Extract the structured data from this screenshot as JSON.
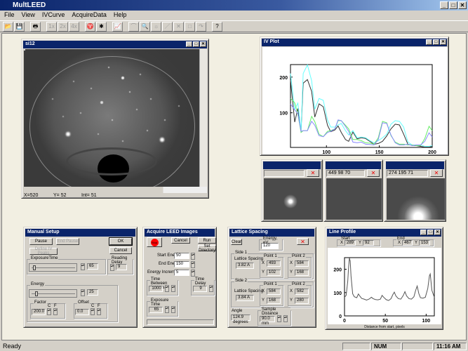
{
  "app": {
    "title": "MultLEED"
  },
  "menu": [
    "File",
    "View",
    "IVCurve",
    "AcquireData",
    "Help"
  ],
  "toolbar": [
    {
      "icon": "open-icon",
      "label": "📂"
    },
    {
      "icon": "save-icon",
      "label": "💾"
    },
    {
      "icon": "print-icon",
      "label": "🖶"
    },
    {
      "icon": "zoom-1x-icon",
      "label": "1x"
    },
    {
      "icon": "zoom-2x-icon",
      "label": "2x"
    },
    {
      "icon": "zoom-4x-icon",
      "label": "4x"
    },
    {
      "icon": "spot-icon",
      "label": "♈"
    },
    {
      "icon": "mark-icon",
      "label": "✱"
    },
    {
      "icon": "chart-icon",
      "label": "📈"
    },
    {
      "icon": "arc-icon",
      "label": "⌒"
    },
    {
      "icon": "magnify-icon",
      "label": "🔍"
    },
    {
      "icon": "sun-icon",
      "label": "☼"
    },
    {
      "icon": "line-icon",
      "label": "／"
    },
    {
      "icon": "cross-icon",
      "label": "✕"
    },
    {
      "icon": "square-icon",
      "label": "□"
    },
    {
      "icon": "curve-icon",
      "label": "↷"
    },
    {
      "icon": "help-icon",
      "label": "?"
    }
  ],
  "image_window": {
    "title": "si12",
    "status": [
      "X=520",
      "Y= 52",
      "Int= 51"
    ]
  },
  "iv_plot": {
    "title": "IV Plot"
  },
  "spot_windows": [
    {
      "readout": ""
    },
    {
      "readout": "449  98   70"
    },
    {
      "readout": "274 195   71"
    }
  ],
  "manual_setup": {
    "title": "Manual Setup",
    "pause": "Pause",
    "end_pause": "End Pause",
    "define": "Define IV Peaks",
    "ok": "OK",
    "cancel": "Cancel",
    "exposure_label": "ExposureTime",
    "exposure_value": "65",
    "reading_delay_label": "Reading Delay",
    "reading_delay_value": "9",
    "energy_label": "Energy",
    "energy_value": "25",
    "factor_label": "Factor",
    "factor_value": "200.0",
    "offset_label": "Offset",
    "offset_value": "0.0",
    "c": "C",
    "f": "F"
  },
  "acquire": {
    "title": "Acquire LEED Images",
    "stop": "Stop",
    "cancel": "Cancel",
    "run": "Run",
    "set_dir": "Set Directory",
    "start_label": "Start Energy",
    "start_value": "50",
    "end_label": "End Energy",
    "end_value": "150",
    "inc_label": "Energy Increment",
    "inc_value": "5",
    "tbi_label": "Time Between Images",
    "tbi_value": "1000",
    "delay_label": "Time Delay",
    "delay_value": "9",
    "exp_label": "Exposure Time",
    "exp_value": "65",
    "c": "C",
    "f": "F"
  },
  "lattice": {
    "title": "Lattice Spacing",
    "clear": "Clear",
    "energy_label": "Energy, eV",
    "energy_value": "120",
    "side1": "Side 1",
    "side2": "Side 2",
    "ls_label": "Lattice Spacing",
    "ls1": "3.82 A",
    "ls2": "3.84 A",
    "p1": "Point 1",
    "p2": "Point 2",
    "x": "X",
    "y": "Y",
    "s1p1x": "493",
    "s1p1y": "102",
    "s1p2x": "584",
    "s1p2y": "168",
    "s2p1x": "584",
    "s2p1y": "168",
    "s2p2x": "582",
    "s2p2y": "280",
    "angle_label": "Angle",
    "angle_value": "124.9 degrees",
    "sd_label": "Sample Distance",
    "sd_value": "90.0 mm",
    "c": "C",
    "f": "F"
  },
  "line_profile": {
    "title": "Line Profile",
    "start": "Start",
    "end": "End",
    "x": "X",
    "y": "Y",
    "sx": "289",
    "sy": "92",
    "ex": "467",
    "ey": "153",
    "xlabel": "Distance from start, pixels"
  },
  "status": {
    "text": "Ready",
    "num": "NUM",
    "time": "11:16 AM"
  },
  "chart_data": [
    {
      "type": "line",
      "title": "IV Plot",
      "xlim": [
        66,
        200
      ],
      "ylim": [
        3,
        235
      ],
      "xticks": [
        100,
        150,
        200
      ],
      "yticks": [
        100,
        200
      ],
      "x": [
        66,
        70,
        73,
        76,
        78,
        82,
        86,
        89,
        93,
        97,
        101,
        104,
        108,
        111,
        114,
        118,
        121,
        125,
        129,
        133,
        137,
        141,
        145,
        149,
        153,
        157,
        161,
        165,
        169,
        173,
        177,
        181,
        185,
        189,
        193,
        197,
        200
      ],
      "series": [
        {
          "name": "black",
          "color": "#303030",
          "values": [
            192,
            74,
            112,
            50,
            183,
            193,
            160,
            88,
            125,
            117,
            65,
            47,
            52,
            63,
            45,
            25,
            20,
            46,
            27,
            30,
            28,
            20,
            12,
            14,
            20,
            35,
            55,
            68,
            66,
            40,
            12,
            9,
            8,
            6,
            4,
            4,
            6
          ]
        },
        {
          "name": "cyan",
          "color": "#66ffff",
          "values": [
            210,
            110,
            127,
            50,
            210,
            234,
            190,
            110,
            140,
            135,
            80,
            60,
            60,
            66,
            70,
            50,
            38,
            50,
            30,
            32,
            30,
            22,
            16,
            22,
            30,
            40,
            68,
            78,
            76,
            60,
            18,
            10,
            10,
            10,
            6,
            6,
            8
          ]
        },
        {
          "name": "green",
          "color": "#66ee66",
          "values": [
            140,
            128,
            95,
            45,
            50,
            50,
            90,
            75,
            40,
            33,
            48,
            50,
            55,
            78,
            78,
            65,
            55,
            25,
            25,
            22,
            16,
            15,
            12,
            30,
            76,
            72,
            36,
            18,
            12,
            12,
            10,
            10,
            8,
            8,
            28,
            62,
            50
          ]
        },
        {
          "name": "blue",
          "color": "#8888ff",
          "values": [
            125,
            108,
            98,
            48,
            50,
            50,
            76,
            65,
            36,
            33,
            45,
            48,
            55,
            80,
            78,
            62,
            48,
            18,
            16,
            18,
            12,
            11,
            10,
            25,
            72,
            70,
            38,
            16,
            10,
            10,
            12,
            8,
            10,
            10,
            20,
            44,
            32
          ]
        }
      ]
    },
    {
      "type": "line",
      "title": "Line Profile",
      "xlabel": "Distance from start, pixels",
      "xlim": [
        0,
        110
      ],
      "ylim": [
        0,
        250
      ],
      "xticks": [
        0,
        50,
        100
      ],
      "yticks": [
        0,
        100,
        200
      ],
      "x": [
        0,
        2,
        4,
        5,
        6,
        7,
        8,
        10,
        12,
        15,
        17,
        19,
        21,
        24,
        27,
        30,
        33,
        35,
        38,
        41,
        44,
        46,
        48,
        51,
        54,
        57,
        59,
        61,
        63,
        66,
        69,
        72,
        74,
        76,
        79,
        82,
        85,
        87,
        89,
        91,
        93,
        96,
        99,
        102,
        104,
        105,
        107,
        110
      ],
      "values": [
        80,
        88,
        150,
        210,
        248,
        235,
        170,
        95,
        82,
        78,
        94,
        84,
        75,
        72,
        68,
        72,
        80,
        74,
        70,
        69,
        72,
        88,
        80,
        70,
        66,
        74,
        90,
        102,
        85,
        74,
        72,
        88,
        104,
        86,
        74,
        72,
        82,
        108,
        128,
        96,
        78,
        76,
        80,
        118,
        172,
        180,
        110,
        80
      ]
    }
  ]
}
